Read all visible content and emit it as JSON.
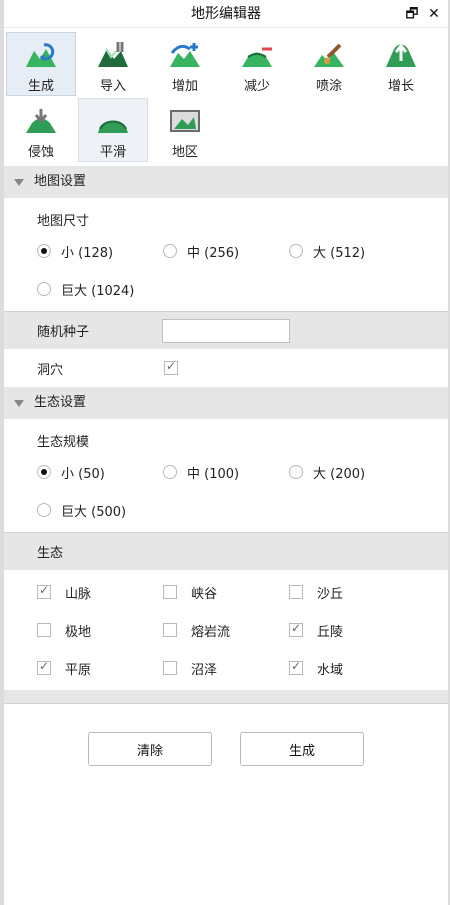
{
  "window": {
    "title": "地形编辑器",
    "actions": {
      "restore": "🗗",
      "close": "✕"
    }
  },
  "tools": [
    {
      "id": "generate",
      "label": "生成",
      "icon": "regenerate-mountain-icon"
    },
    {
      "id": "import",
      "label": "导入",
      "icon": "import-mountain-icon"
    },
    {
      "id": "add",
      "label": "增加",
      "icon": "raise-terrain-icon"
    },
    {
      "id": "reduce",
      "label": "减少",
      "icon": "lower-terrain-icon"
    },
    {
      "id": "paint",
      "label": "喷涂",
      "icon": "paint-brush-icon"
    },
    {
      "id": "grow",
      "label": "增长",
      "icon": "grow-up-arrow-icon"
    },
    {
      "id": "erode",
      "label": "侵蚀",
      "icon": "erode-down-arrow-icon"
    },
    {
      "id": "smooth",
      "label": "平滑",
      "icon": "smooth-hill-icon"
    },
    {
      "id": "region",
      "label": "地区",
      "icon": "region-image-icon"
    }
  ],
  "sections": {
    "map_settings": {
      "header": "地图设置",
      "size_label": "地图尺寸",
      "sizes": [
        {
          "label": "小 (128)",
          "checked": true
        },
        {
          "label": "中 (256)",
          "checked": false
        },
        {
          "label": "大 (512)",
          "checked": false
        },
        {
          "label": "巨大 (1024)",
          "checked": false
        }
      ],
      "seed_label": "随机种子",
      "seed_value": "",
      "cave_label": "洞穴",
      "cave_checked": true
    },
    "eco_settings": {
      "header": "生态设置",
      "scale_label": "生态规模",
      "scales": [
        {
          "label": "小 (50)",
          "checked": true
        },
        {
          "label": "中 (100)",
          "checked": false
        },
        {
          "label": "大 (200)",
          "checked": false
        },
        {
          "label": "巨大 (500)",
          "checked": false
        }
      ],
      "eco_label": "生态",
      "ecos": [
        {
          "label": "山脉",
          "checked": true
        },
        {
          "label": "峡谷",
          "checked": false
        },
        {
          "label": "沙丘",
          "checked": false
        },
        {
          "label": "极地",
          "checked": false
        },
        {
          "label": "熔岩流",
          "checked": false
        },
        {
          "label": "丘陵",
          "checked": true
        },
        {
          "label": "平原",
          "checked": true
        },
        {
          "label": "沼泽",
          "checked": false
        },
        {
          "label": "水域",
          "checked": true
        }
      ]
    }
  },
  "buttons": {
    "clear": "清除",
    "generate": "生成"
  },
  "colors": {
    "icon_green": "#3aa35a",
    "icon_dark": "#1f6b3c",
    "selected_bg": "#e7edf4"
  }
}
